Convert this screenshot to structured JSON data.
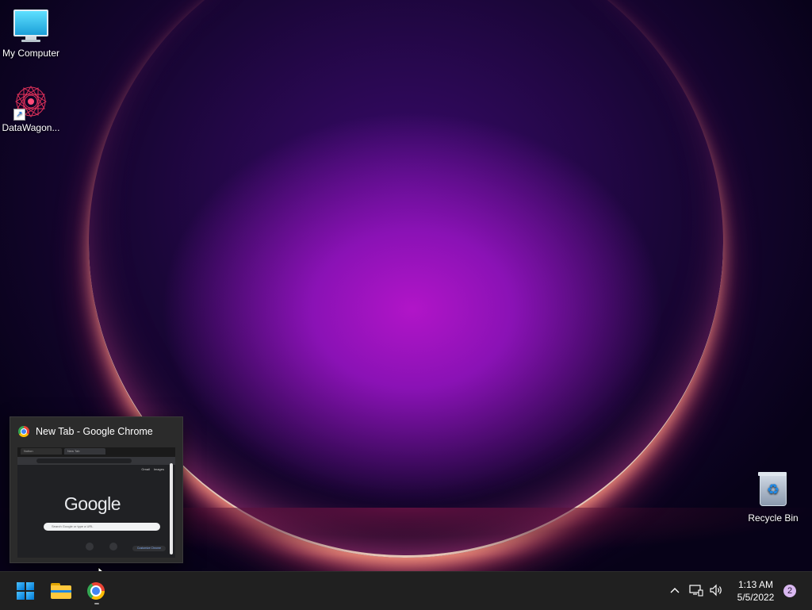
{
  "desktop": {
    "icons": [
      {
        "label": "My Computer",
        "icon": "monitor-icon"
      },
      {
        "label": "DataWagon...",
        "icon": "datawagon-shortcut-icon"
      },
      {
        "label": "Recycle Bin",
        "icon": "recycle-bin-icon"
      }
    ]
  },
  "preview": {
    "title": "New Tab - Google Chrome",
    "thumbnail": {
      "tab1": "Notion",
      "tab2": "New Tab",
      "links": [
        "Gmail",
        "Images"
      ],
      "logo": "Google",
      "search_placeholder": "Search Google or type a URL",
      "customize": "Customize Chrome"
    }
  },
  "taskbar": {
    "apps": [
      {
        "name": "Start",
        "icon": "windows-start-icon"
      },
      {
        "name": "File Explorer",
        "icon": "file-explorer-icon"
      },
      {
        "name": "Google Chrome",
        "icon": "chrome-icon"
      }
    ],
    "tray": {
      "time": "1:13 AM",
      "date": "5/5/2022",
      "notification_count": "2"
    }
  },
  "colors": {
    "accent": "#0078d4",
    "taskbar_bg": "#202020"
  }
}
